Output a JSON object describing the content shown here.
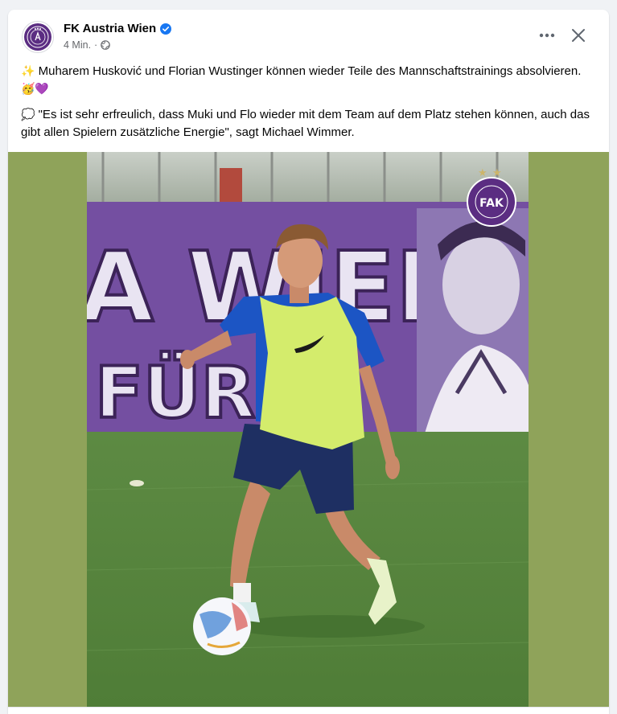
{
  "post": {
    "page_name": "FK Austria Wien",
    "verified_icon": "verified-badge-icon",
    "time": "4 Min.",
    "separator": "·",
    "audience_icon": "globe-icon",
    "paragraphs": [
      {
        "prefix_emoji": "✨",
        "text": "Muharem Husković und Florian Wustinger können wieder Teile des Mannschaftstrainings absolvieren.",
        "suffix_emoji": "🥳💜"
      },
      {
        "prefix_emoji": "💭",
        "text": "\"Es ist sehr erfreulich, dass Muki und Flo wieder mit dem Team auf dem Platz stehen können, auch das gibt allen Spielern zusätzliche Energie\", sagt Michael Wimmer.",
        "suffix_emoji": ""
      }
    ],
    "more_icon": "more-options-icon",
    "close_icon": "close-icon"
  },
  "photo": {
    "wall_text_1": "A WIEN",
    "wall_text_2": "FÜR...",
    "logo_text": "FAK",
    "logo_ring_text": "FUSSBALLKLUB · AUSTRIA WIEN"
  },
  "colors": {
    "media_background": "#8fa35a",
    "brand_purple": "#5b2d82",
    "verified_blue": "#1877f2"
  }
}
